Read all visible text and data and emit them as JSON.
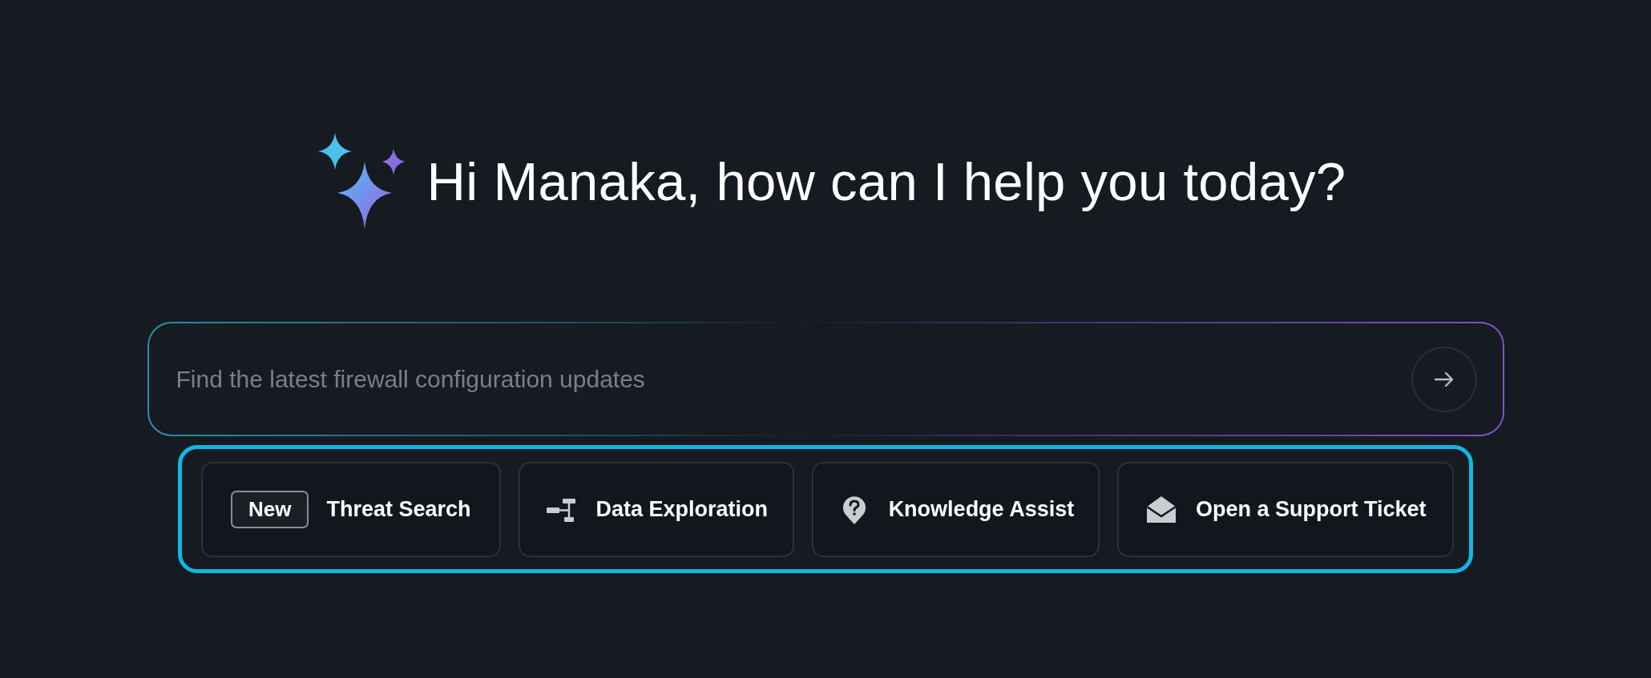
{
  "greeting": "Hi Manaka, how can I help you today?",
  "prompt": {
    "placeholder": "Find the latest firewall configuration updates"
  },
  "quick_actions": [
    {
      "kind": "badge",
      "badge": "New",
      "label": "Threat Search"
    },
    {
      "kind": "exploration",
      "label": "Data Exploration"
    },
    {
      "kind": "knowledge",
      "label": "Knowledge Assist"
    },
    {
      "kind": "ticket",
      "label": "Open a Support Ticket"
    }
  ]
}
